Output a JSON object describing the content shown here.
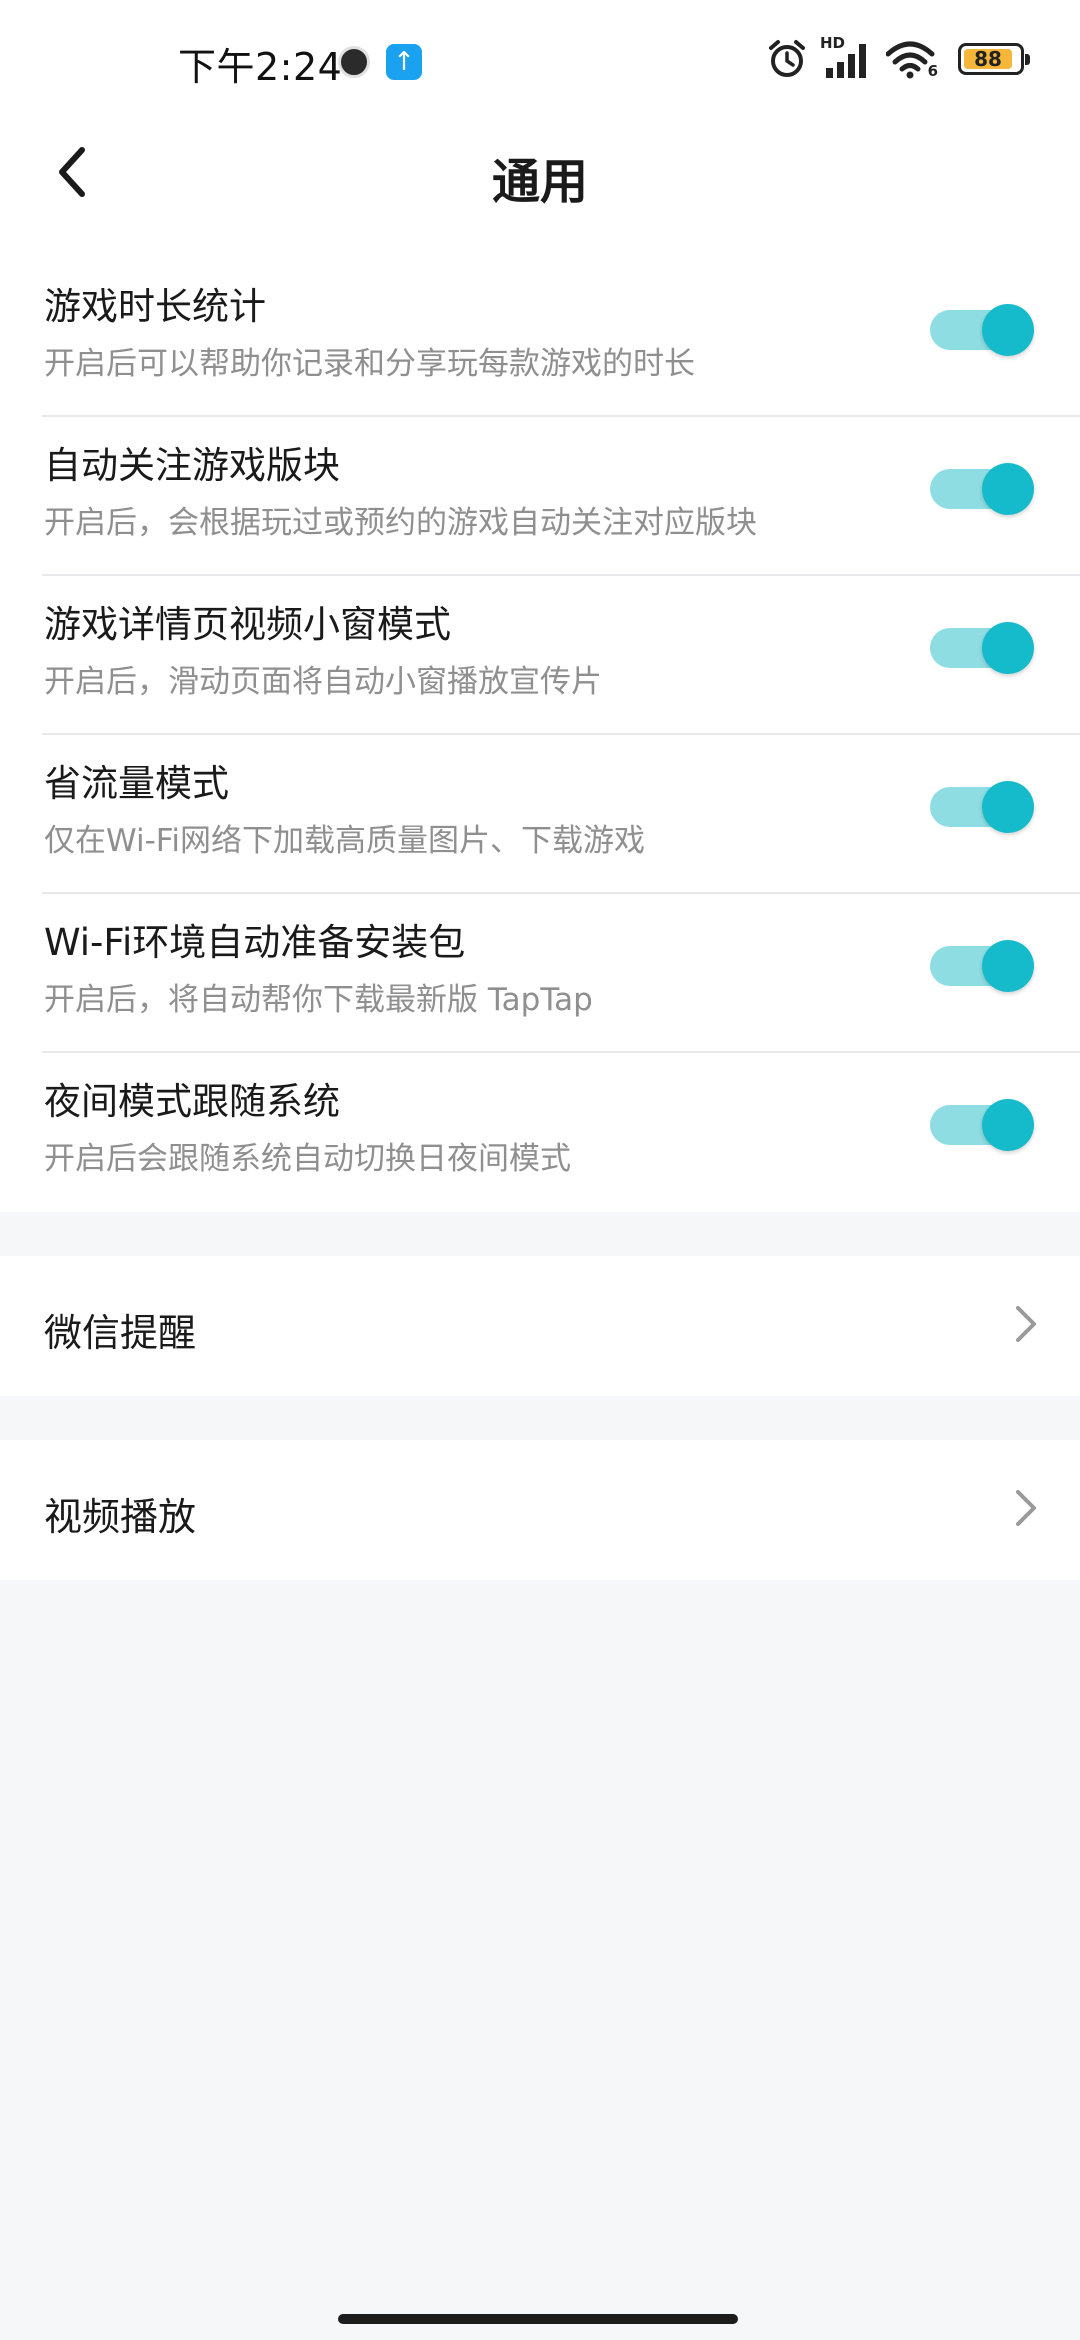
{
  "status_bar": {
    "time": "下午2:24",
    "battery": "88",
    "network_label": "HD",
    "wifi_label": "6"
  },
  "nav": {
    "title": "通用"
  },
  "toggles": [
    {
      "title": "游戏时长统计",
      "subtitle": "开启后可以帮助你记录和分享玩每款游戏的时长",
      "on": true
    },
    {
      "title": "自动关注游戏版块",
      "subtitle": "开启后，会根据玩过或预约的游戏自动关注对应版块",
      "on": true
    },
    {
      "title": "游戏详情页视频小窗模式",
      "subtitle": "开启后，滑动页面将自动小窗播放宣传片",
      "on": true
    },
    {
      "title": "省流量模式",
      "subtitle": "仅在Wi-Fi网络下加载高质量图片、下载游戏",
      "on": true
    },
    {
      "title": "Wi-Fi环境自动准备安装包",
      "subtitle": "开启后，将自动帮你下载最新版 TapTap",
      "on": true
    },
    {
      "title": "夜间模式跟随系统",
      "subtitle": "开启后会跟随系统自动切换日夜间模式",
      "on": true
    }
  ],
  "links": [
    {
      "label": "微信提醒"
    },
    {
      "label": "视频播放"
    }
  ],
  "colors": {
    "accent": "#15bbca",
    "track": "#8edde3",
    "background": "#f6f7f9"
  }
}
